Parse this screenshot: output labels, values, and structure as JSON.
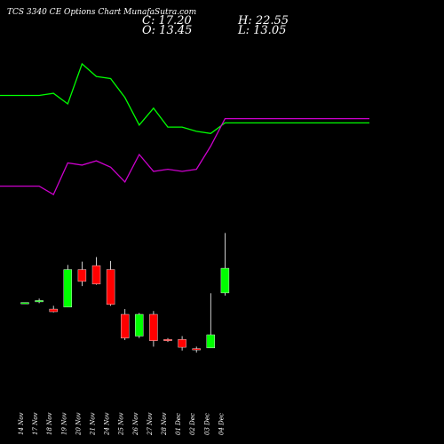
{
  "header": {
    "title": "TCS 3340 CE Options Chart MunafaSutra.com",
    "close_label": "C: 17.20",
    "high_label": "H: 22.55",
    "open_label": "O: 13.45",
    "low_label": "L: 13.05"
  },
  "chart_data": {
    "type": "candlestick",
    "categories": [
      "14 Nov",
      "17 Nov",
      "18 Nov",
      "19 Nov",
      "20 Nov",
      "21 Nov",
      "24 Nov",
      "25 Nov",
      "26 Nov",
      "27 Nov",
      "28 Nov",
      "01 Dec",
      "02 Dec",
      "03 Dec",
      "04 Dec"
    ],
    "ohlc": [
      {
        "open": 12.0,
        "high": 12.0,
        "low": 12.0,
        "close": 12.0
      },
      {
        "open": 12.1,
        "high": 12.6,
        "low": 11.9,
        "close": 12.3
      },
      {
        "open": 11.0,
        "high": 11.5,
        "low": 10.5,
        "close": 10.6
      },
      {
        "open": 11.3,
        "high": 17.7,
        "low": 11.3,
        "close": 17.0
      },
      {
        "open": 17.0,
        "high": 18.2,
        "low": 14.5,
        "close": 15.2
      },
      {
        "open": 17.6,
        "high": 18.9,
        "low": 14.7,
        "close": 14.8
      },
      {
        "open": 17.0,
        "high": 18.3,
        "low": 11.5,
        "close": 11.7
      },
      {
        "open": 10.2,
        "high": 11.0,
        "low": 6.3,
        "close": 6.6
      },
      {
        "open": 6.9,
        "high": 10.4,
        "low": 6.6,
        "close": 10.2
      },
      {
        "open": 10.2,
        "high": 10.7,
        "low": 5.3,
        "close": 6.2
      },
      {
        "open": 6.4,
        "high": 6.6,
        "low": 6.0,
        "close": 6.2
      },
      {
        "open": 6.4,
        "high": 6.9,
        "low": 4.7,
        "close": 5.2
      },
      {
        "open": 5.0,
        "high": 5.3,
        "low": 4.4,
        "close": 4.8
      },
      {
        "open": 5.1,
        "high": 13.4,
        "low": 5.1,
        "close": 7.1
      },
      {
        "open": 13.45,
        "high": 22.55,
        "low": 13.05,
        "close": 17.2
      }
    ],
    "series": [
      {
        "color": "#00ff00",
        "values": [
          100,
          100,
          101,
          96,
          115,
          109,
          108,
          99,
          86,
          94,
          85,
          85,
          83,
          82,
          87
        ]
      },
      {
        "color": "#cc00cc",
        "values": [
          57,
          57,
          53,
          68,
          67,
          69,
          66,
          59,
          72,
          64,
          65,
          64,
          65,
          76,
          89
        ]
      }
    ],
    "up_color": "#00ff00",
    "down_color": "#ff0000"
  }
}
